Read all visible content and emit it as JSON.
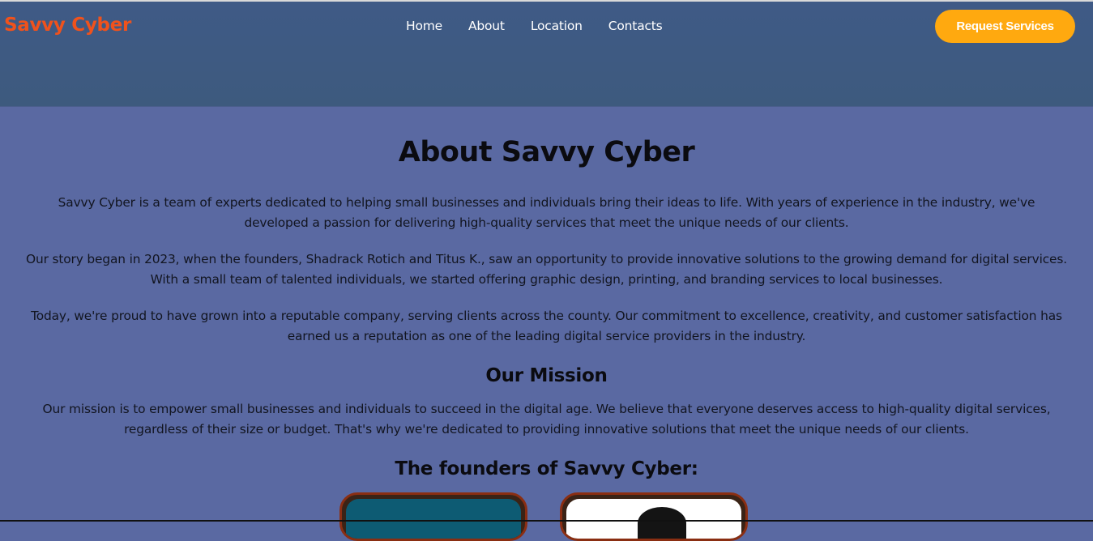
{
  "header": {
    "logo": "Savvy Cyber",
    "nav": [
      "Home",
      "About",
      "Location",
      "Contacts"
    ],
    "cta": "Request Services"
  },
  "about": {
    "title": "About Savvy Cyber",
    "paragraphs": [
      "Savvy Cyber is a team of experts dedicated to helping small businesses and individuals bring their ideas to life. With years of experience in the industry, we've developed a passion for delivering high-quality services that meet the unique needs of our clients.",
      "Our story began in 2023, when the founders, Shadrack Rotich and Titus K., saw an opportunity to provide innovative solutions to the growing demand for digital services. With a small team of talented individuals, we started offering graphic design, printing, and branding services to local businesses.",
      "Today, we're proud to have grown into a reputable company, serving clients across the county. Our commitment to excellence, creativity, and customer satisfaction has earned us a reputation as one of the leading digital service providers in the industry."
    ],
    "mission_title": "Our Mission",
    "mission_text": "Our mission is to empower small businesses and individuals to succeed in the digital age. We believe that everyone deserves access to high-quality digital services, regardless of their size or budget. That's why we're dedicated to providing innovative solutions that meet the unique needs of our clients.",
    "founders_title": "The founders of Savvy Cyber:"
  },
  "colors": {
    "logo": "#f0521c",
    "cta": "#ffa90f",
    "header_bg": "#3f5a86",
    "page_bg": "#5a69a2"
  }
}
